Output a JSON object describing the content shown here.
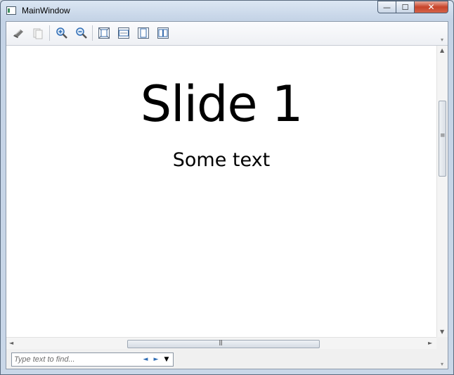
{
  "window": {
    "title": "MainWindow"
  },
  "caption": {
    "minimize": "—",
    "maximize": "☐",
    "close": "✕"
  },
  "toolbar": {
    "tools": [
      {
        "name": "print-icon"
      },
      {
        "name": "copy-icon"
      },
      {
        "name": "zoom-in-icon"
      },
      {
        "name": "zoom-out-icon"
      },
      {
        "name": "actual-size-icon"
      },
      {
        "name": "page-width-icon"
      },
      {
        "name": "whole-page-icon"
      },
      {
        "name": "two-pages-icon"
      }
    ]
  },
  "document": {
    "slide_title": "Slide 1",
    "slide_text": "Some text"
  },
  "find": {
    "placeholder": "Type text to find...",
    "prev": "◄",
    "next": "►",
    "options": "▼"
  }
}
